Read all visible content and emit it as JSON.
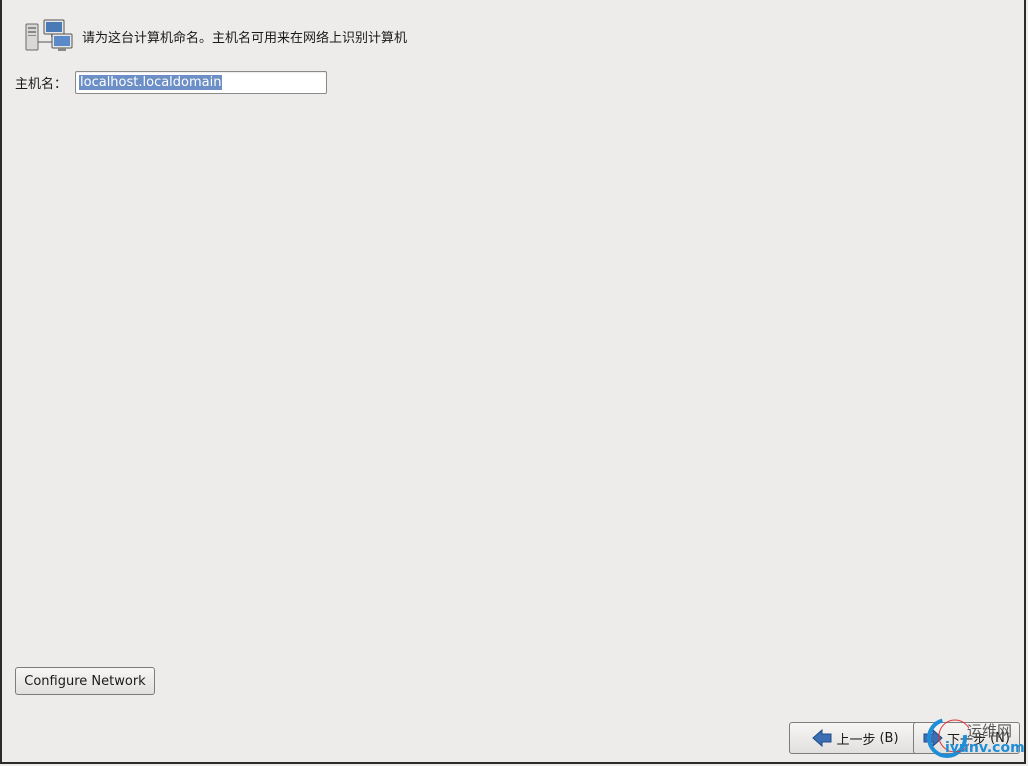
{
  "header": {
    "icon": "network-computers-icon",
    "text": "请为这台计算机命名。主机名可用来在网络上识别计算机"
  },
  "hostname": {
    "label": "主机名：",
    "value": "localhost.localdomain"
  },
  "configure_network": {
    "label": "Configure Network"
  },
  "nav": {
    "back_label": "上一步",
    "back_key": "(B)",
    "back_icon": "arrow-left-icon",
    "next_label": "下一步",
    "next_key": "(N)",
    "next_icon": "arrow-right-icon"
  },
  "watermark": {
    "line1": "运维网",
    "line2": "iyunv.com"
  }
}
